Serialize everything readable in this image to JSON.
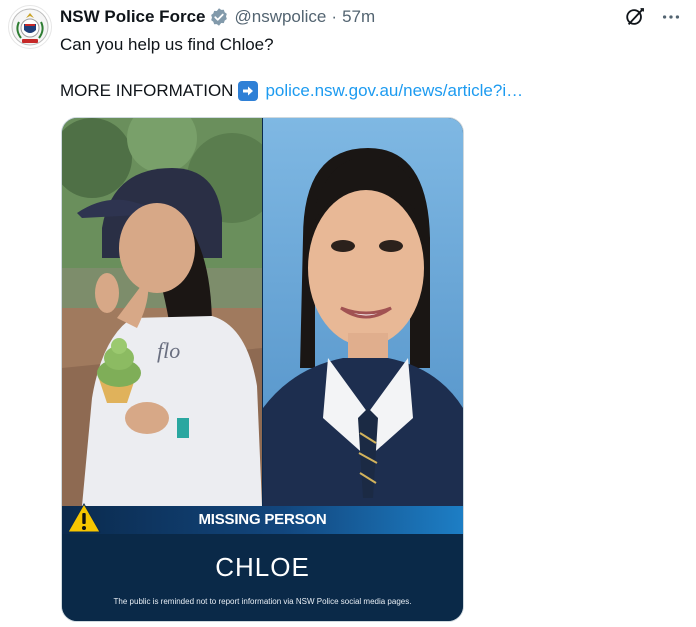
{
  "post": {
    "display_name": "NSW Police Force",
    "handle": "@nswpolice",
    "separator": "·",
    "timestamp": "57m",
    "text_line1": "Can you help us find Chloe?",
    "text_prefix": "MORE INFORMATION",
    "link_text": "police.nsw.gov.au/news/article?i…"
  },
  "icons": {
    "verified": "verified-badge-icon",
    "grok": "grok-icon",
    "more": "more-options-icon",
    "arrow": "right-arrow-emoji-icon",
    "warning": "warning-triangle-icon"
  },
  "media": {
    "banner_title": "MISSING PERSON",
    "name": "CHLOE",
    "disclaimer": "The public is reminded not to report information via NSW Police social media pages."
  },
  "colors": {
    "link": "#1d9bf0",
    "banner_dark": "#0b2a4d",
    "banner_light": "#1d7ec5",
    "warning": "#f7c600"
  }
}
